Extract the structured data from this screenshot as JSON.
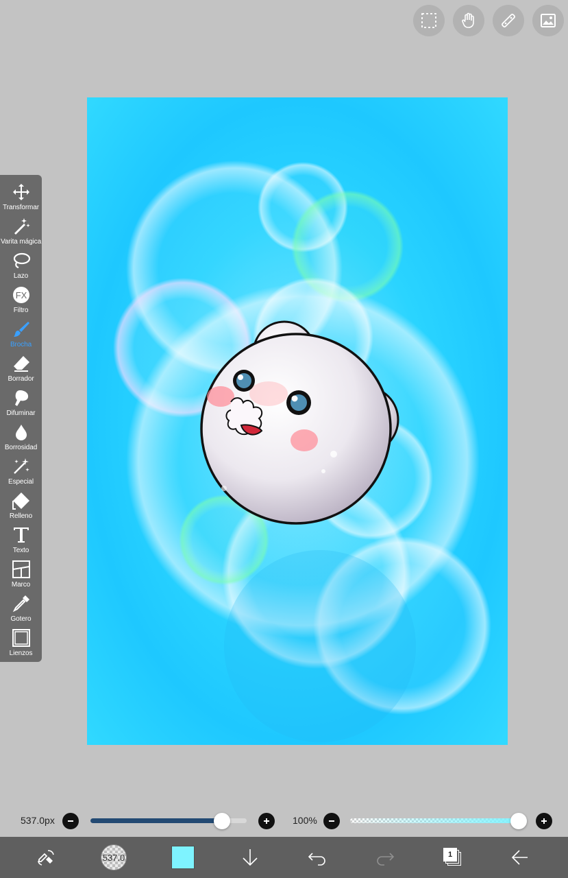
{
  "top_buttons": [
    "selection-icon",
    "hand-icon",
    "ruler-icon",
    "gallery-icon"
  ],
  "tools": [
    {
      "label": "Transformar",
      "icon": "move-icon"
    },
    {
      "label": "Varita mágica",
      "icon": "magic-wand-icon"
    },
    {
      "label": "Lazo",
      "icon": "lasso-icon"
    },
    {
      "label": "Filtro",
      "icon": "fx-icon"
    },
    {
      "label": "Brocha",
      "icon": "brush-icon",
      "active": true
    },
    {
      "label": "Borrador",
      "icon": "eraser-icon"
    },
    {
      "label": "Difuminar",
      "icon": "smudge-icon"
    },
    {
      "label": "Borrosidad",
      "icon": "blur-icon"
    },
    {
      "label": "Especial",
      "icon": "sparkle-icon"
    },
    {
      "label": "Relleno",
      "icon": "fill-icon"
    },
    {
      "label": "Texto",
      "icon": "text-icon"
    },
    {
      "label": "Marco",
      "icon": "frame-icon"
    },
    {
      "label": "Gotero",
      "icon": "eyedropper-icon"
    },
    {
      "label": "Lienzos",
      "icon": "canvas-icon"
    }
  ],
  "brush_size": {
    "label": "537.0px",
    "fraction": 0.84
  },
  "opacity": {
    "label": "100%",
    "fraction": 1.0
  },
  "bottombar": {
    "brush_preview_label": "537.0",
    "layer_count": "1",
    "current_color": "#7ef3ff"
  },
  "colors": {
    "accent": "#3aa0ff",
    "toolbar_bg": "#6a6a6a",
    "bottombar_bg": "#5f5f5f",
    "slider_fill": "#234a73"
  }
}
